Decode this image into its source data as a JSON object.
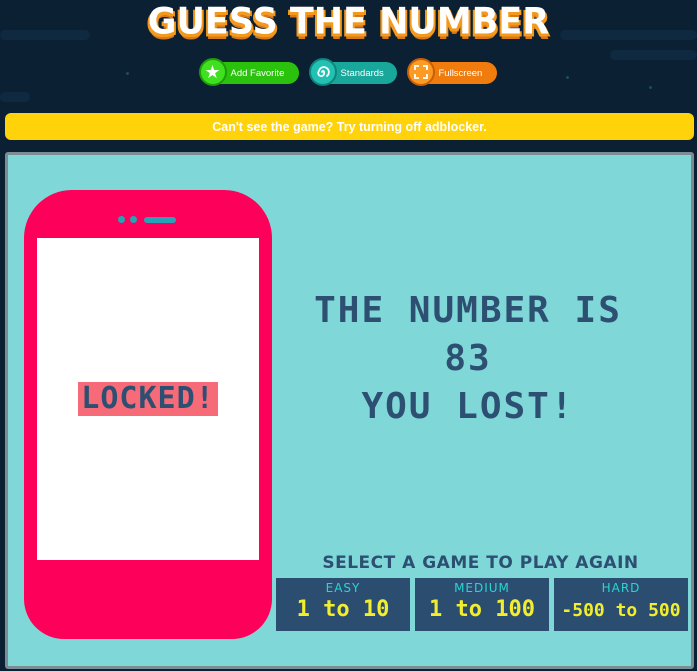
{
  "header": {
    "title": "GUESS THE NUMBER"
  },
  "toolbar": {
    "favorite_label": "Add Favorite",
    "standards_label": "Standards",
    "fullscreen_label": "Fullscreen",
    "favorite_icon": "star-icon",
    "standards_icon": "spiral-icon",
    "fullscreen_icon": "expand-icon"
  },
  "notice": {
    "text": "Can't see the game? Try turning off adblocker."
  },
  "game": {
    "phone_status": "LOCKED!",
    "result_line1": "THE NUMBER IS",
    "result_number": "83",
    "result_line3": "YOU LOST!",
    "play_again_prompt": "SELECT A GAME TO PLAY AGAIN",
    "modes": [
      {
        "level": "EASY",
        "range": "1 to 10"
      },
      {
        "level": "MEDIUM",
        "range": "1 to 100"
      },
      {
        "level": "HARD",
        "range": "-500 to 500"
      }
    ]
  },
  "colors": {
    "background": "#0c2033",
    "game_bg": "#80d7d7",
    "phone": "#fd0059",
    "text_dark": "#2c4f72",
    "mode_range": "#f2ed2e",
    "mode_level": "#2bd4d1",
    "adbar": "#ffd20a"
  }
}
